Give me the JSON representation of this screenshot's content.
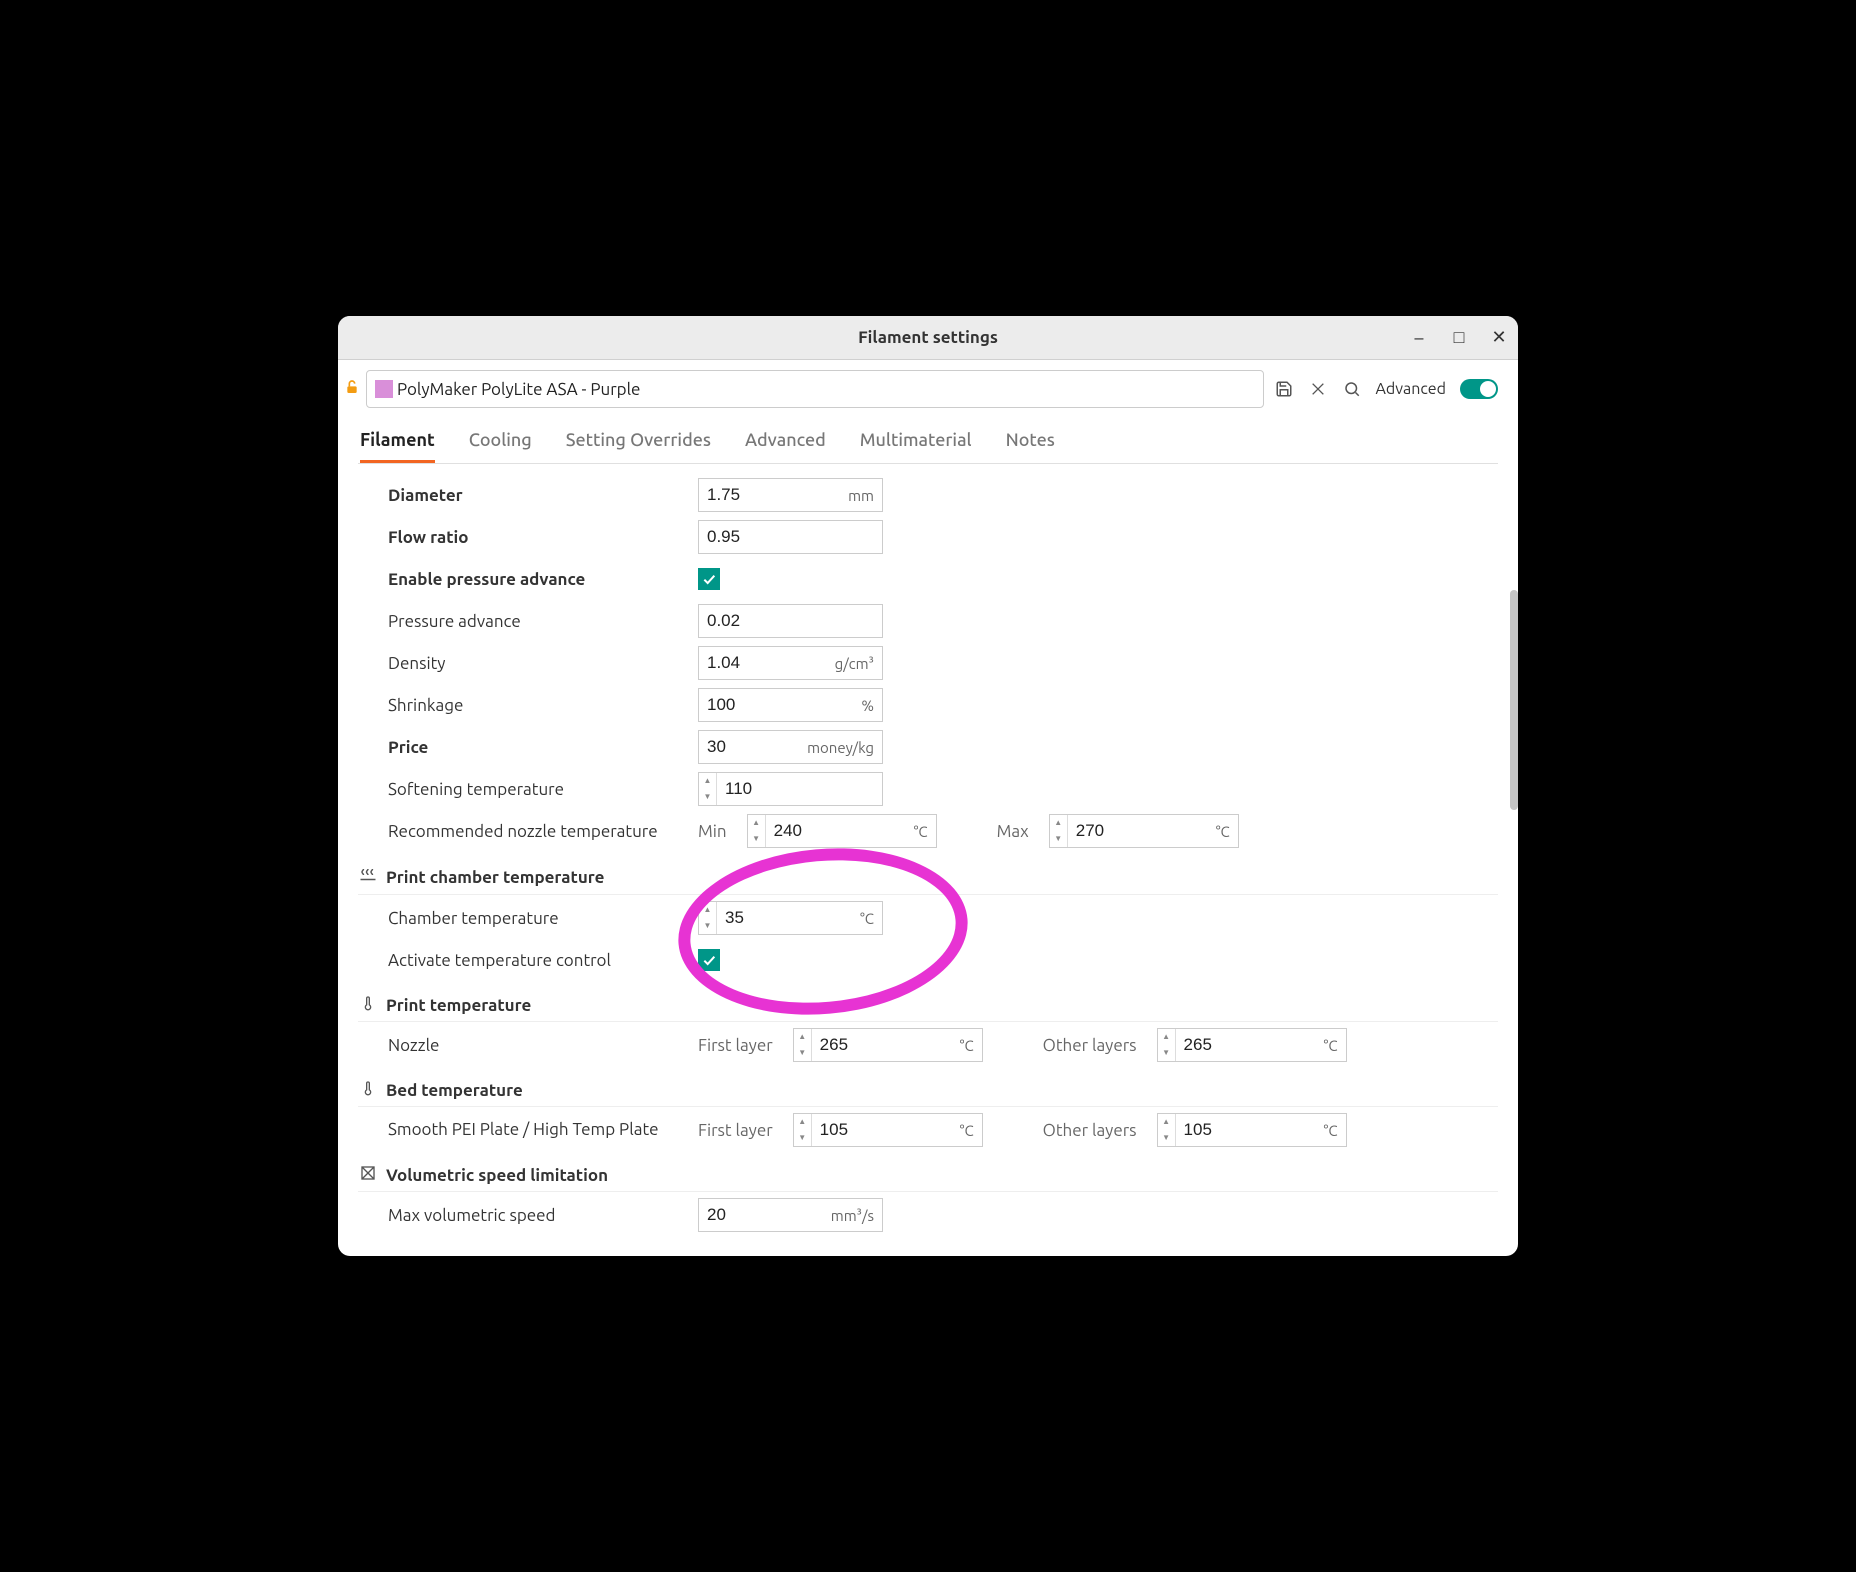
{
  "window": {
    "title": "Filament settings"
  },
  "preset": {
    "name": "PolyMaker PolyLite ASA - Purple",
    "swatch_color": "#d98fd9"
  },
  "toolbar": {
    "advanced_label": "Advanced"
  },
  "tabs": {
    "filament": "Filament",
    "cooling": "Cooling",
    "overrides": "Setting Overrides",
    "advanced": "Advanced",
    "multimaterial": "Multimaterial",
    "notes": "Notes"
  },
  "labels": {
    "diameter": "Diameter",
    "flow_ratio": "Flow ratio",
    "enable_pa": "Enable pressure advance",
    "pa": "Pressure advance",
    "density": "Density",
    "shrinkage": "Shrinkage",
    "price": "Price",
    "softening": "Softening temperature",
    "rec_nozzle": "Recommended nozzle temperature",
    "section_chamber": "Print chamber temperature",
    "chamber_temp": "Chamber temperature",
    "activate_tc": "Activate temperature control",
    "section_print": "Print temperature",
    "nozzle": "Nozzle",
    "section_bed": "Bed temperature",
    "smooth_pei": "Smooth PEI Plate / High Temp Plate",
    "section_vol": "Volumetric speed limitation",
    "max_vol": "Max volumetric speed",
    "min": "Min",
    "max": "Max",
    "first_layer": "First layer",
    "other_layers": "Other layers"
  },
  "units": {
    "mm": "mm",
    "gcm3": "g/cm³",
    "pct": "%",
    "moneykg": "money/kg",
    "degc": "°C",
    "mm3s": "mm³/s"
  },
  "values": {
    "diameter": "1.75",
    "flow_ratio": "0.95",
    "pa": "0.02",
    "density": "1.04",
    "shrinkage": "100",
    "price": "30",
    "softening": "110",
    "rec_min": "240",
    "rec_max": "270",
    "chamber": "35",
    "nozzle_first": "265",
    "nozzle_other": "265",
    "bed_first": "105",
    "bed_other": "105",
    "max_vol": "20"
  }
}
